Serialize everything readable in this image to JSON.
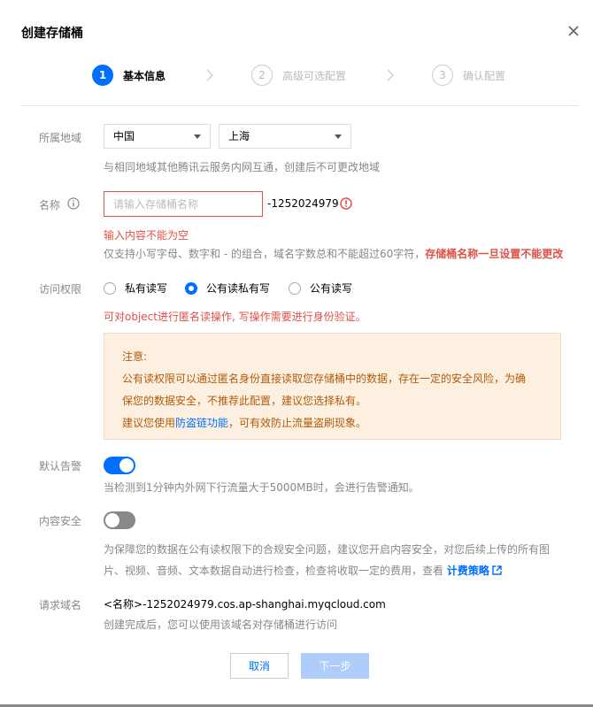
{
  "dialog": {
    "title": "创建存储桶"
  },
  "steps": [
    {
      "num": "1",
      "label": "基本信息"
    },
    {
      "num": "2",
      "label": "高级可选配置"
    },
    {
      "num": "3",
      "label": "确认配置"
    }
  ],
  "region": {
    "label": "所属地域",
    "country": "中国",
    "city": "上海",
    "hint": "与相同地域其他腾讯云服务内网互通，创建后不可更改地域"
  },
  "name": {
    "label": "名称",
    "placeholder": "请输入存储桶名称",
    "value": "",
    "suffix": "-1252024979",
    "error": "输入内容不能为空",
    "rule_text": "仅支持小写字母、数字和 - 的组合，域名字数总和不能超过60字符，",
    "rule_emphasis": "存储桶名称一旦设置不能更改"
  },
  "access": {
    "label": "访问权限",
    "options": [
      "私有读写",
      "公有读私有写",
      "公有读写"
    ],
    "selected": "公有读私有写",
    "notice": "可对object进行匿名读操作, 写操作需要进行身份验证。",
    "box": {
      "title": "注意:",
      "line1": "公有读权限可以通过匿名身份直接读取您存储桶中的数据，存在一定的安全风险，为确",
      "line2": "保您的数据安全，不推荐此配置，建议您选择私有。",
      "line3_pre": "建议您使用",
      "line3_link": "防盗链功能",
      "line3_post": "，可有效防止流量盗刷现象。"
    }
  },
  "alarm": {
    "label": "默认告警",
    "enabled": true,
    "hint": "当检测到1分钟内外网下行流量大于5000MB时，会进行告警通知。"
  },
  "content_security": {
    "label": "内容安全",
    "enabled": false,
    "text": "为保障您的数据在公有读权限下的合规安全问题，建议您开启内容安全，对您后续上传的所有图片、视频、音频、文本数据自动进行检查，检查将收取一定的费用，查看 ",
    "link": "计费策略"
  },
  "request_domain": {
    "label": "请求域名",
    "value": "<名称>-1252024979.cos.ap-shanghai.myqcloud.com",
    "hint": "创建完成后，您可以使用该域名对存储桶进行访问"
  },
  "buttons": {
    "cancel": "取消",
    "next": "下一步"
  },
  "colors": {
    "primary": "#006eff",
    "error": "#e1504a",
    "notice_bg": "#fdf0e1",
    "notice_text": "#b25b0a"
  }
}
